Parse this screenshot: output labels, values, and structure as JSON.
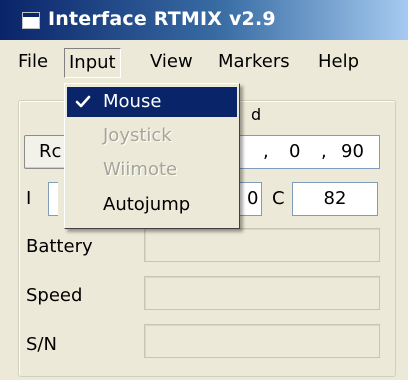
{
  "window": {
    "title": "Interface RTMIX v2.9"
  },
  "menubar": {
    "items": [
      {
        "label": "File"
      },
      {
        "label": "Input"
      },
      {
        "label": "View"
      },
      {
        "label": "Markers"
      },
      {
        "label": "Help"
      }
    ]
  },
  "input_menu": {
    "items": [
      {
        "label": "Mouse",
        "checked": true,
        "enabled": true,
        "highlighted": true
      },
      {
        "label": "Joystick",
        "checked": false,
        "enabled": false
      },
      {
        "label": "Wiimote",
        "checked": false,
        "enabled": false
      },
      {
        "label": "Autojump",
        "checked": false,
        "enabled": true
      }
    ]
  },
  "panel": {
    "group_title_fragment": "d",
    "button_label_fragment": "Rc",
    "coords": {
      "sep1": ",",
      "v1": "0",
      "sep2": ",",
      "v2": "90"
    },
    "i_label": "I",
    "ci_value_fragment": "0",
    "c_label": "C",
    "c_value": "82",
    "rows": [
      {
        "label": "Battery",
        "value": ""
      },
      {
        "label": "Speed",
        "value": ""
      },
      {
        "label": "S/N",
        "value": ""
      }
    ]
  },
  "colors": {
    "titlebar_start": "#0a246a",
    "titlebar_end": "#a6caf0",
    "menu_highlight": "#0a246a",
    "face": "#ece9d8"
  }
}
